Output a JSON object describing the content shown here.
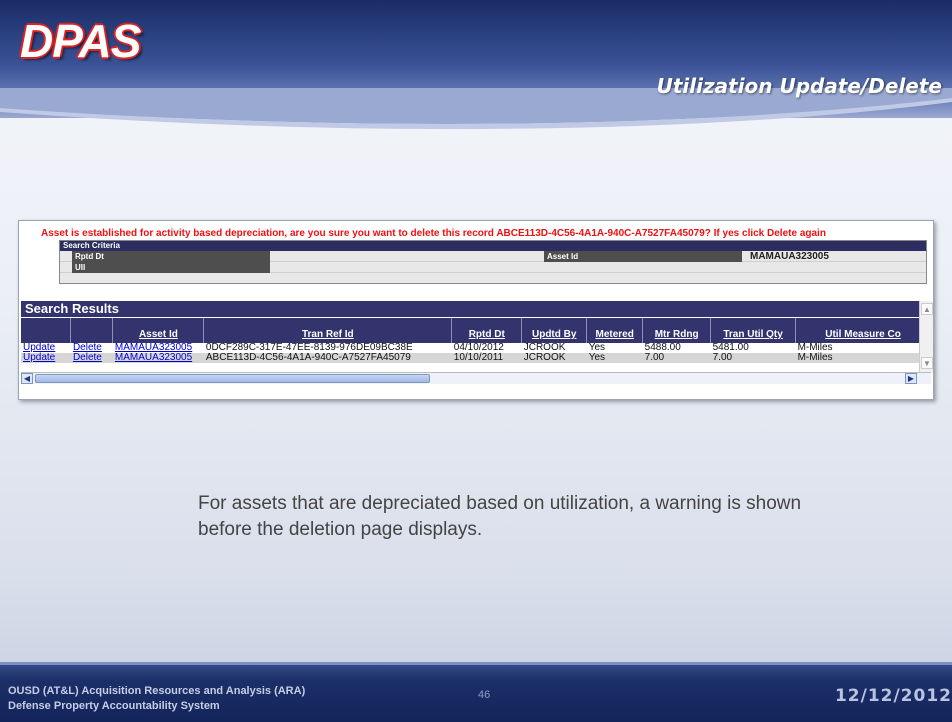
{
  "header": {
    "logo_text": "DPAS",
    "slide_title": "Utilization Update/Delete"
  },
  "warning": "Asset is established for activity based depreciation, are you sure you want to delete this record ABCE113D-4C56-4A1A-940C-A7527FA45079? If yes click Delete again",
  "search_criteria": {
    "title": "Search Criteria",
    "rptd_dt_label": "Rptd Dt",
    "asset_id_label": "Asset Id",
    "asset_id_value": "MAMAUA323005",
    "uii_label": "UII"
  },
  "search_results": {
    "title": "Search Results",
    "columns": [
      "",
      "",
      "Asset Id",
      "Tran Ref Id",
      "Rptd Dt",
      "Updtd By",
      "Metered",
      "Mtr Rdng",
      "Tran Util Qty",
      "Util Measure Co"
    ],
    "rows": [
      {
        "update": "Update",
        "delete": "Delete",
        "asset_id": "MAMAUA323005",
        "tran_ref_id": "0DCF289C-317E-47EE-8139-976DE09BC38E",
        "rptd_dt": "04/10/2012",
        "updtd_by": "JCROOK",
        "metered": "Yes",
        "mtr_rdng": "5488.00",
        "tran_util_qty": "5481.00",
        "util_measure": "M-Miles"
      },
      {
        "update": "Update",
        "delete": "Delete",
        "asset_id": "MAMAUA323005",
        "tran_ref_id": "ABCE113D-4C56-4A1A-940C-A7527FA45079",
        "rptd_dt": "10/10/2011",
        "updtd_by": "JCROOK",
        "metered": "Yes",
        "mtr_rdng": "7.00",
        "tran_util_qty": "7.00",
        "util_measure": "M-Miles"
      }
    ]
  },
  "caption": "For assets that are depreciated based on utilization, a warning is shown before the deletion page displays.",
  "footer": {
    "org_line1": "OUSD (AT&L) Acquisition Resources and Analysis (ARA)",
    "org_line2": "Defense Property Accountability System",
    "page_number": "46",
    "date": "12/12/2012"
  },
  "colors": {
    "header_navy": "#1a2c66",
    "table_header": "#33336e",
    "warning_red": "#ee1111",
    "link_blue": "#0000cc"
  }
}
